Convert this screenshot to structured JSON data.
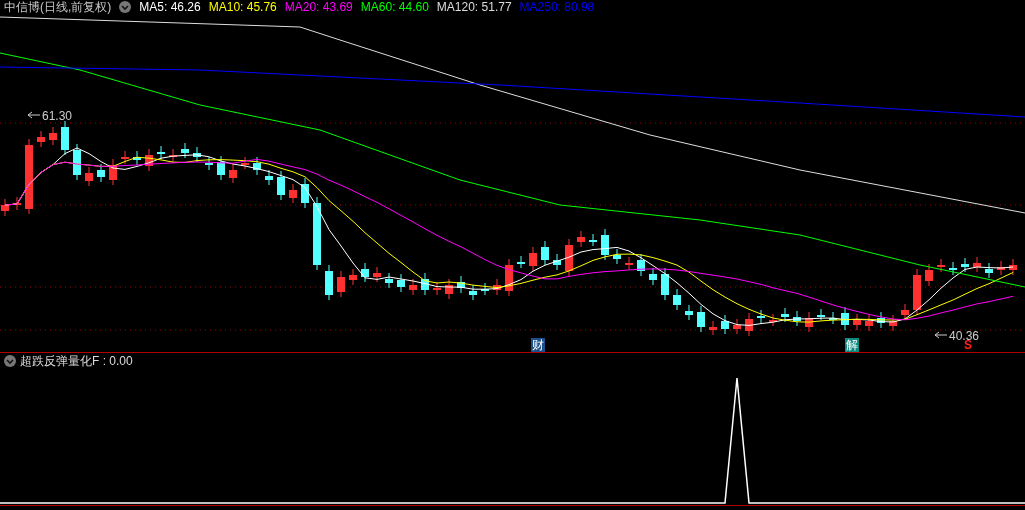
{
  "header": {
    "title": "中信博(日线,前复权)",
    "legend": [
      {
        "label": "MA5: 46.26",
        "color": "#ffffff"
      },
      {
        "label": "MA10: 45.76",
        "color": "#ffff00"
      },
      {
        "label": "MA20: 43.69",
        "color": "#ff00ff"
      },
      {
        "label": "MA60: 44.60",
        "color": "#00ff00"
      },
      {
        "label": "MA120: 51.77",
        "color": "#dddddd"
      },
      {
        "label": "MA250: 80.98",
        "color": "#0000ff"
      }
    ]
  },
  "main_chart": {
    "high_label": "61.30",
    "low_label": "40.36",
    "markers": [
      {
        "kind": "badge",
        "text": "财",
        "color": "#1d4f8a"
      },
      {
        "kind": "badge",
        "text": "解",
        "color": "#0e8a80"
      },
      {
        "kind": "signal",
        "text": "S",
        "color": "#ff2020"
      }
    ]
  },
  "indicator": {
    "label": "超跌反弹量化F : 0.00"
  }
}
